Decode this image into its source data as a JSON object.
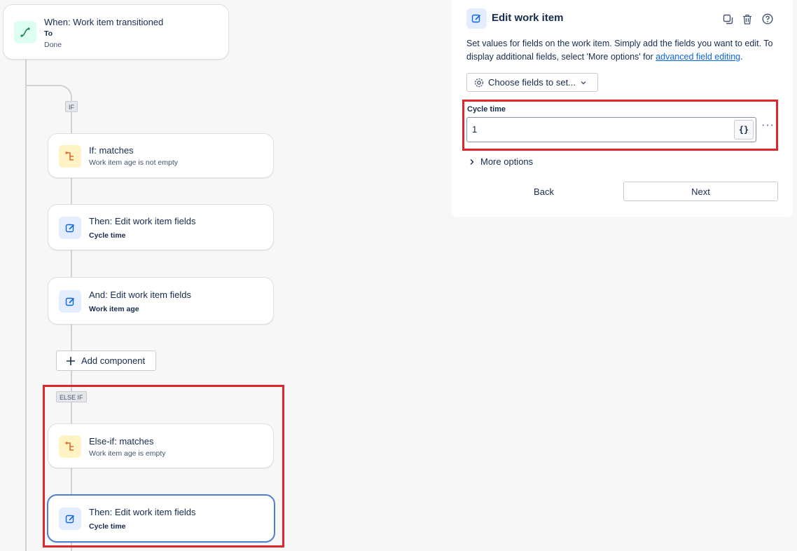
{
  "trigger": {
    "title": "When: Work item transitioned",
    "sub_label": "To",
    "sub_value": "Done",
    "icon": "branch-icon"
  },
  "badges": {
    "if": "IF",
    "else_if": "ELSE IF"
  },
  "if_branch": {
    "condition": {
      "title": "If: matches",
      "subtitle": "Work item age is not empty"
    },
    "action1": {
      "title": "Then: Edit work item fields",
      "subtitle": "Cycle time"
    },
    "action2": {
      "title": "And: Edit work item fields",
      "subtitle": "Work item age"
    },
    "add_component": "Add component"
  },
  "else_if_branch": {
    "condition": {
      "title": "Else-if: matches",
      "subtitle": "Work item age is empty"
    },
    "action1": {
      "title": "Then: Edit work item fields",
      "subtitle": "Cycle time"
    }
  },
  "panel": {
    "title": "Edit work item",
    "description": "Set values for fields on the work item. Simply add the fields you want to edit. To display additional fields, select 'More options' for",
    "link": "advanced field editing",
    "description_end": ".",
    "choose_fields": "Choose fields to set...",
    "field_label": "Cycle time",
    "field_value": "1",
    "brace_button": "{}",
    "more_options": "More options",
    "back": "Back",
    "next": "Next"
  },
  "colors": {
    "highlight": "#e0262b",
    "selected_border": "#4a7fd4",
    "link": "#0c66e4"
  }
}
